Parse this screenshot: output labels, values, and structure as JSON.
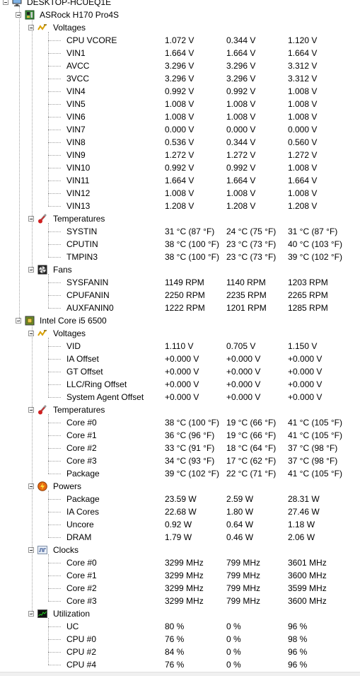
{
  "tree": [
    {
      "level": 0,
      "label": "DESKTOP-HCUEQ1E",
      "icon": "computer-icon",
      "expanded": true
    },
    {
      "level": 1,
      "label": "ASRock H170 Pro4S",
      "icon": "motherboard-icon",
      "expanded": true
    },
    {
      "level": 2,
      "label": "Voltages",
      "icon": "voltage-icon",
      "expanded": true
    },
    {
      "level": 3,
      "label": "CPU VCORE",
      "v": [
        "1.072 V",
        "0.344 V",
        "1.120 V"
      ]
    },
    {
      "level": 3,
      "label": "VIN1",
      "v": [
        "1.664 V",
        "1.664 V",
        "1.664 V"
      ]
    },
    {
      "level": 3,
      "label": "AVCC",
      "v": [
        "3.296 V",
        "3.296 V",
        "3.312 V"
      ]
    },
    {
      "level": 3,
      "label": "3VCC",
      "v": [
        "3.296 V",
        "3.296 V",
        "3.312 V"
      ]
    },
    {
      "level": 3,
      "label": "VIN4",
      "v": [
        "0.992 V",
        "0.992 V",
        "1.008 V"
      ]
    },
    {
      "level": 3,
      "label": "VIN5",
      "v": [
        "1.008 V",
        "1.008 V",
        "1.008 V"
      ]
    },
    {
      "level": 3,
      "label": "VIN6",
      "v": [
        "1.008 V",
        "1.008 V",
        "1.008 V"
      ]
    },
    {
      "level": 3,
      "label": "VIN7",
      "v": [
        "0.000 V",
        "0.000 V",
        "0.000 V"
      ]
    },
    {
      "level": 3,
      "label": "VIN8",
      "v": [
        "0.536 V",
        "0.344 V",
        "0.560 V"
      ]
    },
    {
      "level": 3,
      "label": "VIN9",
      "v": [
        "1.272 V",
        "1.272 V",
        "1.272 V"
      ]
    },
    {
      "level": 3,
      "label": "VIN10",
      "v": [
        "0.992 V",
        "0.992 V",
        "1.008 V"
      ]
    },
    {
      "level": 3,
      "label": "VIN11",
      "v": [
        "1.664 V",
        "1.664 V",
        "1.664 V"
      ]
    },
    {
      "level": 3,
      "label": "VIN12",
      "v": [
        "1.008 V",
        "1.008 V",
        "1.008 V"
      ]
    },
    {
      "level": 3,
      "label": "VIN13",
      "v": [
        "1.208 V",
        "1.208 V",
        "1.208 V"
      ]
    },
    {
      "level": 2,
      "label": "Temperatures",
      "icon": "thermometer-icon",
      "expanded": true
    },
    {
      "level": 3,
      "label": "SYSTIN",
      "v": [
        "31 °C  (87 °F)",
        "24 °C  (75 °F)",
        "31 °C  (87 °F)"
      ]
    },
    {
      "level": 3,
      "label": "CPUTIN",
      "v": [
        "38 °C  (100 °F)",
        "23 °C  (73 °F)",
        "40 °C  (103 °F)"
      ]
    },
    {
      "level": 3,
      "label": "TMPIN3",
      "v": [
        "38 °C  (100 °F)",
        "23 °C  (73 °F)",
        "39 °C  (102 °F)"
      ]
    },
    {
      "level": 2,
      "label": "Fans",
      "icon": "fan-icon",
      "expanded": true
    },
    {
      "level": 3,
      "label": "SYSFANIN",
      "v": [
        "1149 RPM",
        "1140 RPM",
        "1203 RPM"
      ]
    },
    {
      "level": 3,
      "label": "CPUFANIN",
      "v": [
        "2250 RPM",
        "2235 RPM",
        "2265 RPM"
      ]
    },
    {
      "level": 3,
      "label": "AUXFANIN0",
      "v": [
        "1222 RPM",
        "1201 RPM",
        "1285 RPM"
      ]
    },
    {
      "level": 1,
      "label": "Intel Core i5 6500",
      "icon": "cpu-icon",
      "expanded": true
    },
    {
      "level": 2,
      "label": "Voltages",
      "icon": "voltage-icon",
      "expanded": true
    },
    {
      "level": 3,
      "label": "VID",
      "v": [
        "1.110 V",
        "0.705 V",
        "1.150 V"
      ]
    },
    {
      "level": 3,
      "label": "IA Offset",
      "v": [
        "+0.000 V",
        "+0.000 V",
        "+0.000 V"
      ]
    },
    {
      "level": 3,
      "label": "GT Offset",
      "v": [
        "+0.000 V",
        "+0.000 V",
        "+0.000 V"
      ]
    },
    {
      "level": 3,
      "label": "LLC/Ring Offset",
      "v": [
        "+0.000 V",
        "+0.000 V",
        "+0.000 V"
      ]
    },
    {
      "level": 3,
      "label": "System Agent Offset",
      "v": [
        "+0.000 V",
        "+0.000 V",
        "+0.000 V"
      ]
    },
    {
      "level": 2,
      "label": "Temperatures",
      "icon": "thermometer-icon",
      "expanded": true
    },
    {
      "level": 3,
      "label": "Core #0",
      "v": [
        "38 °C  (100 °F)",
        "19 °C  (66 °F)",
        "41 °C  (105 °F)"
      ]
    },
    {
      "level": 3,
      "label": "Core #1",
      "v": [
        "36 °C  (96 °F)",
        "19 °C  (66 °F)",
        "41 °C  (105 °F)"
      ]
    },
    {
      "level": 3,
      "label": "Core #2",
      "v": [
        "33 °C  (91 °F)",
        "18 °C  (64 °F)",
        "37 °C  (98 °F)"
      ]
    },
    {
      "level": 3,
      "label": "Core #3",
      "v": [
        "34 °C  (93 °F)",
        "17 °C  (62 °F)",
        "37 °C  (98 °F)"
      ]
    },
    {
      "level": 3,
      "label": "Package",
      "v": [
        "39 °C  (102 °F)",
        "22 °C  (71 °F)",
        "41 °C  (105 °F)"
      ]
    },
    {
      "level": 2,
      "label": "Powers",
      "icon": "power-icon",
      "expanded": true
    },
    {
      "level": 3,
      "label": "Package",
      "v": [
        "23.59 W",
        "2.59 W",
        "28.31 W"
      ]
    },
    {
      "level": 3,
      "label": "IA Cores",
      "v": [
        "22.68 W",
        "1.80 W",
        "27.46 W"
      ]
    },
    {
      "level": 3,
      "label": "Uncore",
      "v": [
        "0.92 W",
        "0.64 W",
        "1.18 W"
      ]
    },
    {
      "level": 3,
      "label": "DRAM",
      "v": [
        "1.79 W",
        "0.46 W",
        "2.06 W"
      ]
    },
    {
      "level": 2,
      "label": "Clocks",
      "icon": "clock-icon",
      "expanded": true
    },
    {
      "level": 3,
      "label": "Core #0",
      "v": [
        "3299 MHz",
        "799 MHz",
        "3601 MHz"
      ]
    },
    {
      "level": 3,
      "label": "Core #1",
      "v": [
        "3299 MHz",
        "799 MHz",
        "3600 MHz"
      ]
    },
    {
      "level": 3,
      "label": "Core #2",
      "v": [
        "3299 MHz",
        "799 MHz",
        "3599 MHz"
      ]
    },
    {
      "level": 3,
      "label": "Core #3",
      "v": [
        "3299 MHz",
        "799 MHz",
        "3600 MHz"
      ]
    },
    {
      "level": 2,
      "label": "Utilization",
      "icon": "utilization-icon",
      "expanded": true
    },
    {
      "level": 3,
      "label": "UC",
      "v": [
        "80 %",
        "0 %",
        "96 %"
      ]
    },
    {
      "level": 3,
      "label": "CPU #0",
      "v": [
        "76 %",
        "0 %",
        "98 %"
      ]
    },
    {
      "level": 3,
      "label": "CPU #2",
      "v": [
        "84 %",
        "0 %",
        "96 %"
      ]
    },
    {
      "level": 3,
      "label": "CPU #4",
      "v": [
        "76 %",
        "0 %",
        "96 %"
      ]
    }
  ]
}
